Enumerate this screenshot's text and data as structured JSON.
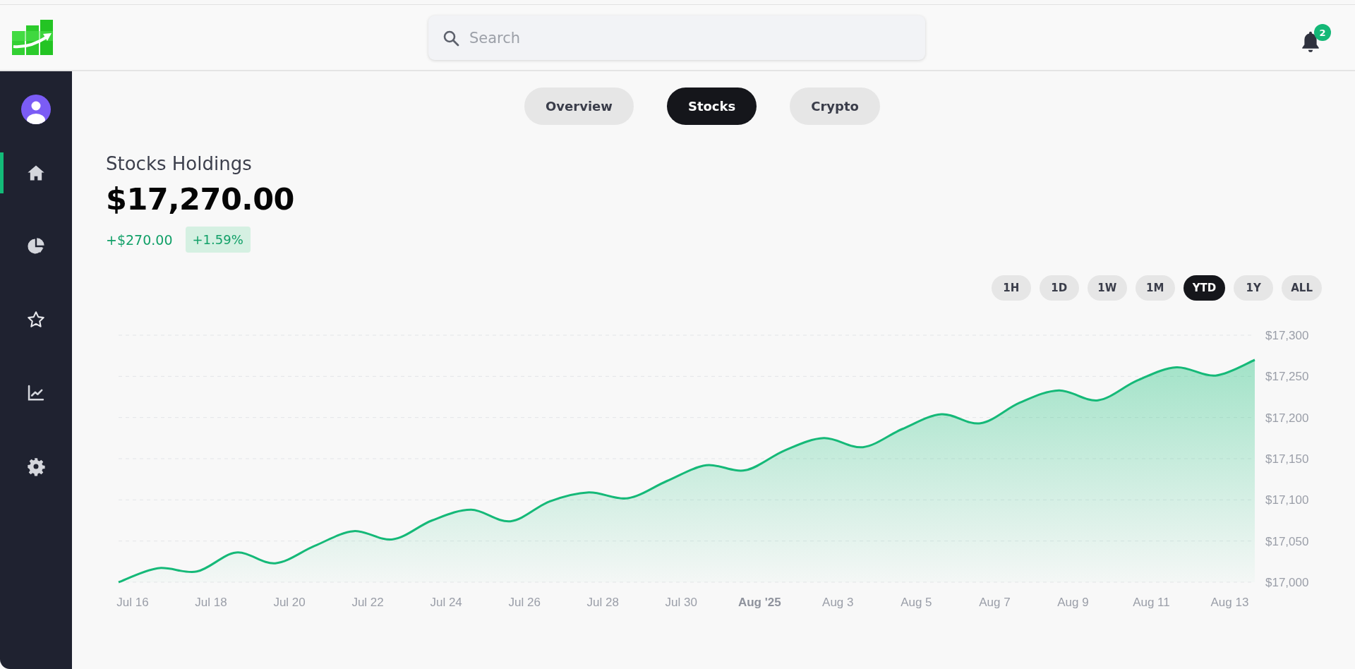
{
  "header": {
    "search": {
      "placeholder": "Search"
    },
    "notifications": {
      "count": "2"
    }
  },
  "sidebar": {
    "items": [
      {
        "kind": "home",
        "selected": true
      },
      {
        "kind": "pie",
        "selected": false
      },
      {
        "kind": "star",
        "selected": false
      },
      {
        "kind": "chart",
        "selected": false
      },
      {
        "kind": "settings",
        "selected": false
      }
    ]
  },
  "tabs": [
    {
      "label": "Overview",
      "selected": false
    },
    {
      "label": "Stocks",
      "selected": true
    },
    {
      "label": "Crypto",
      "selected": false
    }
  ],
  "holdings": {
    "title": "Stocks Holdings",
    "value": "$17,270.00",
    "change": "+$270.00",
    "change_percent": "+1.59%"
  },
  "ranges": [
    {
      "label": "1H",
      "selected": false
    },
    {
      "label": "1D",
      "selected": false
    },
    {
      "label": "1W",
      "selected": false
    },
    {
      "label": "1M",
      "selected": false
    },
    {
      "label": "YTD",
      "selected": true
    },
    {
      "label": "1Y",
      "selected": false
    },
    {
      "label": "ALL",
      "selected": false
    }
  ],
  "chart_data": {
    "type": "area",
    "categories": [
      "Jul 16",
      null,
      "Jul 18",
      null,
      "Jul 20",
      null,
      "Jul 22",
      null,
      "Jul 24",
      null,
      "Jul 26",
      null,
      "Jul 28",
      null,
      "Jul 30",
      null,
      "**Aug '25**",
      null,
      "Aug 3",
      null,
      "Aug 5",
      null,
      "Aug 7",
      null,
      "Aug 9",
      null,
      "Aug 11",
      null,
      "Aug 13",
      null
    ],
    "values": [
      17000,
      17017,
      17013,
      17036,
      17023,
      17044,
      17062,
      17052,
      17075,
      17088,
      17074,
      17098,
      17109,
      17102,
      17123,
      17142,
      17136,
      17160,
      17175,
      17164,
      17186,
      17204,
      17193,
      17218,
      17233,
      17221,
      17245,
      17261,
      17251,
      17270
    ],
    "ylim": [
      17000,
      17300
    ],
    "grid": true,
    "yticks": [
      {
        "value": 17300,
        "label": "$17,300"
      },
      {
        "value": 17250,
        "label": "$17,250"
      },
      {
        "value": 17200,
        "label": "$17,200"
      },
      {
        "value": 17150,
        "label": "$17,150"
      },
      {
        "value": 17100,
        "label": "$17,100"
      },
      {
        "value": 17050,
        "label": "$17,050"
      },
      {
        "value": 17000,
        "label": "$17,000"
      }
    ]
  }
}
